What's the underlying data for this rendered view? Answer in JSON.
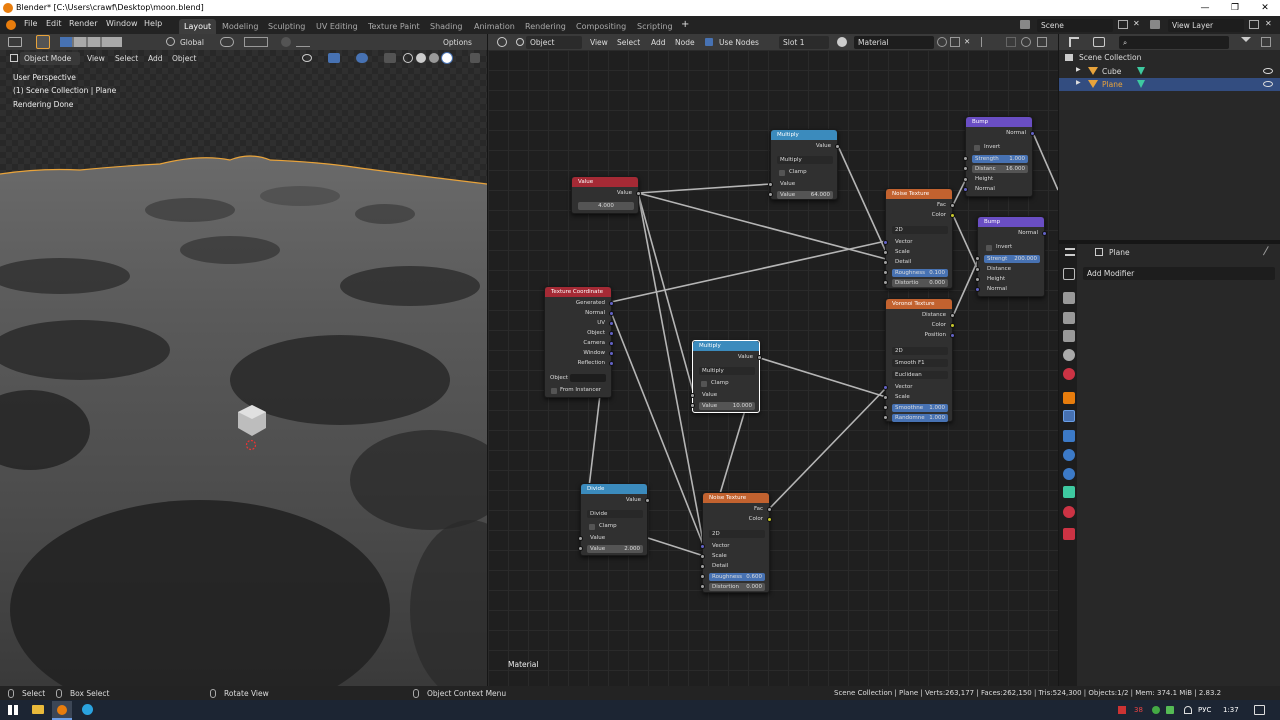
{
  "title": "Blender* [C:\\Users\\crawf\\Desktop\\moon.blend]",
  "menu": [
    "File",
    "Edit",
    "Render",
    "Window",
    "Help"
  ],
  "workspaces": [
    "Layout",
    "Modeling",
    "Sculpting",
    "UV Editing",
    "Texture Paint",
    "Shading",
    "Animation",
    "Rendering",
    "Compositing",
    "Scripting"
  ],
  "scene": "Scene",
  "view_layer": "View Layer",
  "viewport": {
    "transform": "Global",
    "options": "Options",
    "mode": "Object Mode",
    "menus": [
      "View",
      "Select",
      "Add",
      "Object"
    ],
    "overlay": [
      "User Perspective",
      "(1) Scene Collection | Plane",
      "Rendering Done"
    ]
  },
  "node_editor": {
    "object": "Object",
    "menus": [
      "View",
      "Select",
      "Add",
      "Node"
    ],
    "use_nodes": "Use Nodes",
    "slot": "Slot 1",
    "material": "Material",
    "footer": "Material",
    "nodes": {
      "value": {
        "title": "Value",
        "out": "Value",
        "val": "4.000"
      },
      "multiply1": {
        "title": "Multiply",
        "out": "Value",
        "op": "Multiply",
        "clamp": "Clamp",
        "in": "Value",
        "field_label": "Value",
        "field_val": "64.000"
      },
      "texcoord": {
        "title": "Texture Coordinate",
        "outs": [
          "Generated",
          "Normal",
          "UV",
          "Object",
          "Camera",
          "Window",
          "Reflection"
        ],
        "object": "Object",
        "instancer": "From Instancer"
      },
      "multiply2": {
        "title": "Multiply",
        "out": "Value",
        "op": "Multiply",
        "clamp": "Clamp",
        "in": "Value",
        "field_label": "Value",
        "field_val": "10.000"
      },
      "divide": {
        "title": "Divide",
        "out": "Value",
        "op": "Divide",
        "clamp": "Clamp",
        "in": "Value",
        "field_label": "Value",
        "field_val": "2.000"
      },
      "noise1": {
        "title": "Noise Texture",
        "outs": [
          "Fac",
          "Color"
        ],
        "dim": "2D",
        "ins": [
          "Vector",
          "Scale",
          "Detail"
        ],
        "rough_label": "Roughness",
        "rough_val": "0.600",
        "dist_label": "Distortion",
        "dist_val": "0.000"
      },
      "noise2": {
        "title": "Noise Texture",
        "outs": [
          "Fac",
          "Color"
        ],
        "dim": "2D",
        "ins": [
          "Vector",
          "Scale",
          "Detail"
        ],
        "rough_label": "Roughness",
        "rough_val": "0.100",
        "dist_label": "Distortio",
        "dist_val": "0.000"
      },
      "voronoi": {
        "title": "Voronoi Texture",
        "outs": [
          "Distance",
          "Color",
          "Position"
        ],
        "dim": "2D",
        "feature": "Smooth F1",
        "metric": "Euclidean",
        "ins": [
          "Vector",
          "Scale"
        ],
        "smooth_label": "Smoothne",
        "smooth_val": "1.000",
        "rand_label": "Randomne",
        "rand_val": "1.000"
      },
      "bump1": {
        "title": "Bump",
        "out": "Normal",
        "invert": "Invert",
        "str_label": "Strength",
        "str_val": "1.000",
        "dist_label": "Distanc",
        "dist_val": "16.000",
        "ins": [
          "Height",
          "Normal"
        ]
      },
      "bump2": {
        "title": "Bump",
        "out": "Normal",
        "invert": "Invert",
        "str_label": "Strengt",
        "str_val": "200.000",
        "ins": [
          "Distance",
          "Height",
          "Normal"
        ]
      }
    }
  },
  "outliner": {
    "root": "Scene Collection",
    "items": [
      {
        "name": "Cube",
        "selected": false
      },
      {
        "name": "Plane",
        "selected": true
      }
    ]
  },
  "properties": {
    "object": "Plane",
    "add_modifier": "Add Modifier"
  },
  "status": {
    "select": "Select",
    "box_select": "Box Select",
    "rotate": "Rotate View",
    "context": "Object Context Menu",
    "stats": "Scene Collection | Plane | Verts:263,177 | Faces:262,150 | Tris:524,300 | Objects:1/2 | Mem: 374.1 MiB | 2.83.2"
  },
  "taskbar": {
    "lang": "РУС",
    "time": "1:37",
    "tray_num": "38"
  },
  "colors": {
    "accent": "#4772b3",
    "value_header": "#a52a35",
    "texture_header": "#c2622f",
    "vector_header": "#6a4ec4",
    "converter_header": "#3b8bbd",
    "input_header": "#a52a35"
  }
}
